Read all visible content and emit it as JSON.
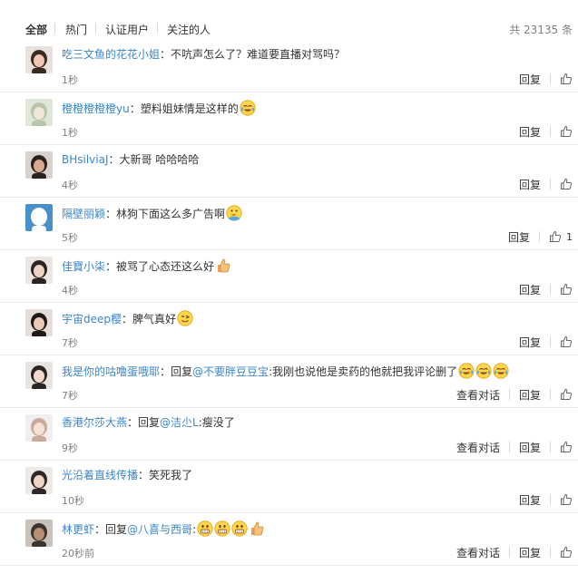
{
  "tabs": {
    "items": [
      {
        "label": "全部",
        "active": true
      },
      {
        "label": "热门",
        "active": false
      },
      {
        "label": "认证用户",
        "active": false
      },
      {
        "label": "关注的人",
        "active": false
      }
    ],
    "total": "共 23135 条"
  },
  "labels": {
    "reply": "回复",
    "view_dialog": "查看对话",
    "reply_prefix": "回复"
  },
  "colors": {
    "username": "#3b86c9",
    "time": "#808080",
    "divider": "#eaeaea"
  },
  "comments": [
    {
      "user": "吃三文鱼的花花小姐",
      "text": "不吭声怎么了？难道要直播对骂吗？",
      "emojis": [],
      "time": "1秒",
      "likes": "",
      "show_dialog": false
    },
    {
      "user": "橙橙橙橙橙yu",
      "text": "塑料姐妹情是这样的",
      "emojis": [
        "laugh-cry-emoji"
      ],
      "time": "1秒",
      "likes": "",
      "show_dialog": false
    },
    {
      "user": "BHsilviaJ",
      "text": "大新哥 哈哈哈哈",
      "emojis": [],
      "time": "4秒",
      "likes": "",
      "show_dialog": false
    },
    {
      "user": "隔壁丽颖",
      "text": "林狗下面这么多广告啊",
      "emojis": [
        "thinking-emoji"
      ],
      "time": "5秒",
      "likes": "1",
      "show_dialog": false
    },
    {
      "user": "佳寶小柒",
      "text": "被骂了心态还这么好",
      "emojis": [
        "thumbs-up-emoji"
      ],
      "time": "4秒",
      "likes": "",
      "show_dialog": false
    },
    {
      "user": "宇宙deep樱",
      "text": "脾气真好",
      "emojis": [
        "wink-emoji"
      ],
      "time": "7秒",
      "likes": "",
      "show_dialog": false
    },
    {
      "user": "我是你的咕噜蛋哦耶",
      "mention": "@不要胖豆豆宝",
      "text": "我刚也说他是卖药的他就把我评论删了",
      "emojis": [
        "laugh-cry-emoji",
        "laugh-cry-emoji",
        "laugh-cry-emoji"
      ],
      "time": "7秒",
      "likes": "",
      "show_dialog": true
    },
    {
      "user": "香港尔莎大燕",
      "mention": "@洁尐L",
      "text": "瘦没了",
      "emojis": [],
      "time": "9秒",
      "likes": "",
      "show_dialog": true
    },
    {
      "user": "光沿着直线传播",
      "text": "笑死我了",
      "emojis": [],
      "time": "10秒",
      "likes": "",
      "show_dialog": false
    },
    {
      "user": "林更虾",
      "mention": "@八喜与西哥",
      "text": "",
      "emojis": [
        "grin-emoji",
        "grin-emoji",
        "grin-emoji",
        "thumbs-up-emoji"
      ],
      "time": "20秒前",
      "likes": "",
      "show_dialog": true
    }
  ]
}
